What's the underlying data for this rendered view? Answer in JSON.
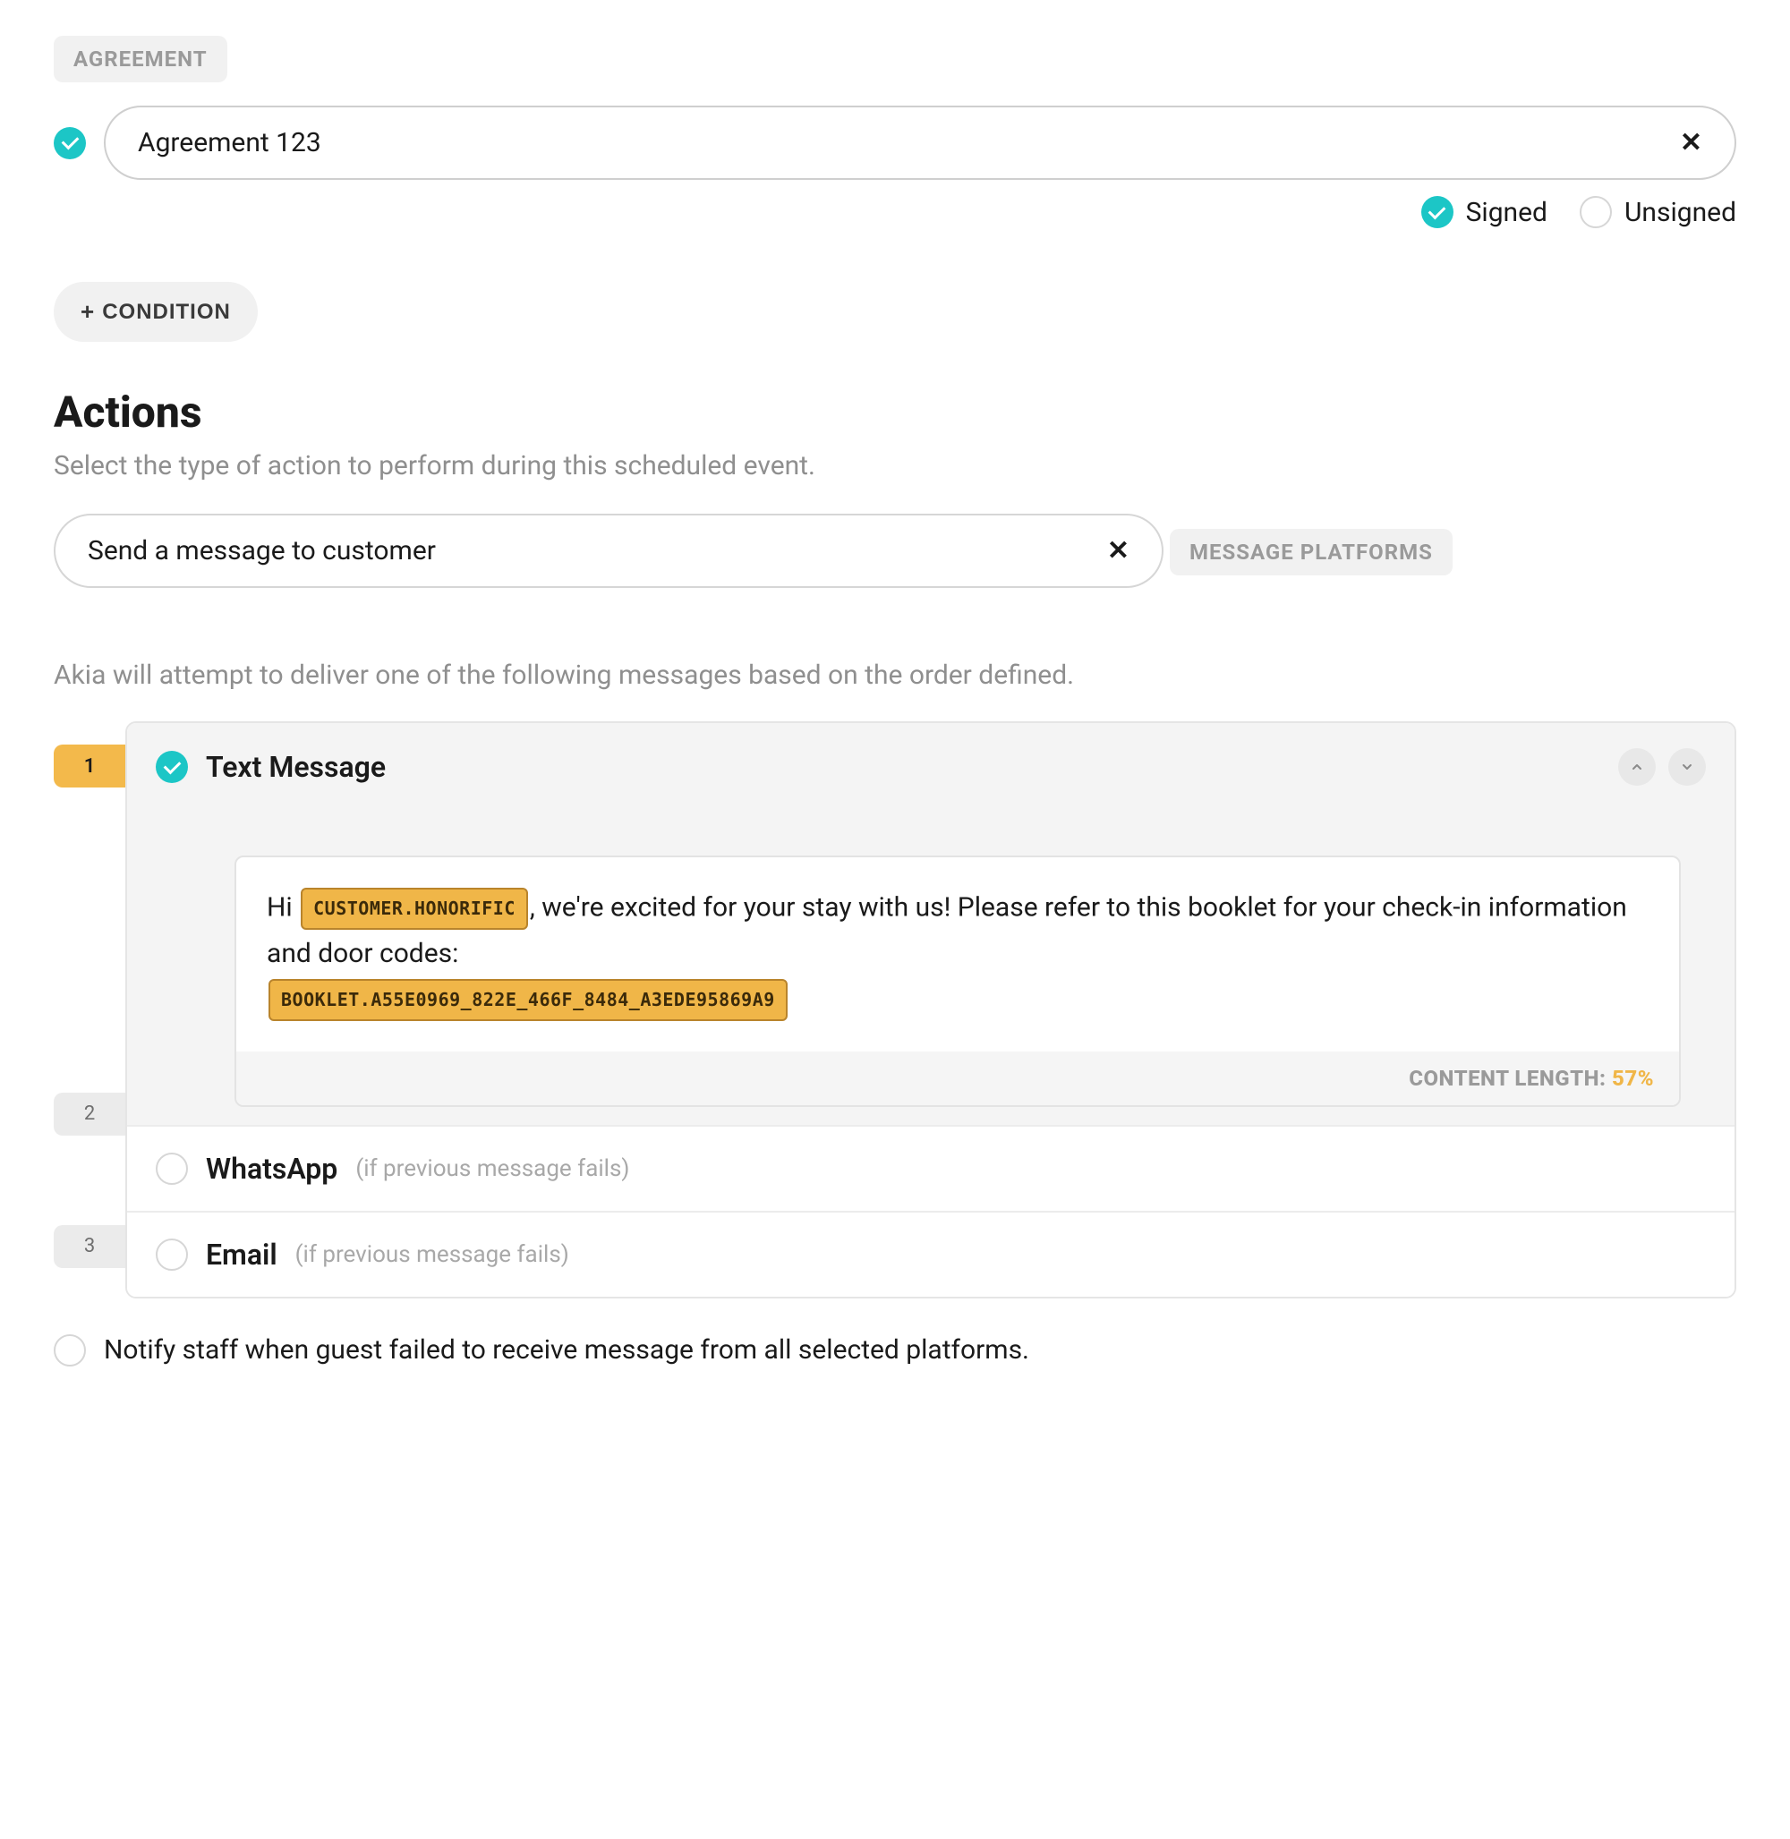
{
  "agreement": {
    "section_label": "AGREEMENT",
    "value": "Agreement 123",
    "signed_label": "Signed",
    "unsigned_label": "Unsigned"
  },
  "condition_button": "CONDITION",
  "actions": {
    "heading": "Actions",
    "subtext": "Select the type of action to perform during this scheduled event.",
    "selected_action": "Send a message to customer"
  },
  "platforms": {
    "section_label": "MESSAGE PLATFORMS",
    "desc": "Akia will attempt to deliver one of the following messages based on the order defined.",
    "items": [
      {
        "order": "1",
        "name": "Text Message",
        "selected": true
      },
      {
        "order": "2",
        "name": "WhatsApp",
        "note": "(if previous message fails)",
        "selected": false
      },
      {
        "order": "3",
        "name": "Email",
        "note": "(if previous message fails)",
        "selected": false
      }
    ]
  },
  "message_editor": {
    "line_prefix": "Hi ",
    "token1": "CUSTOMER.HONORIFIC",
    "line_mid": ", we're excited for your stay with us! Please refer to this booklet for your check-in information and door codes:",
    "token2": "BOOKLET.A55E0969_822E_466F_8484_A3EDE95869A9",
    "footer_label": "CONTENT LENGTH: ",
    "footer_pct": "57%"
  },
  "notify_label": "Notify staff when guest failed to receive message from all selected platforms."
}
